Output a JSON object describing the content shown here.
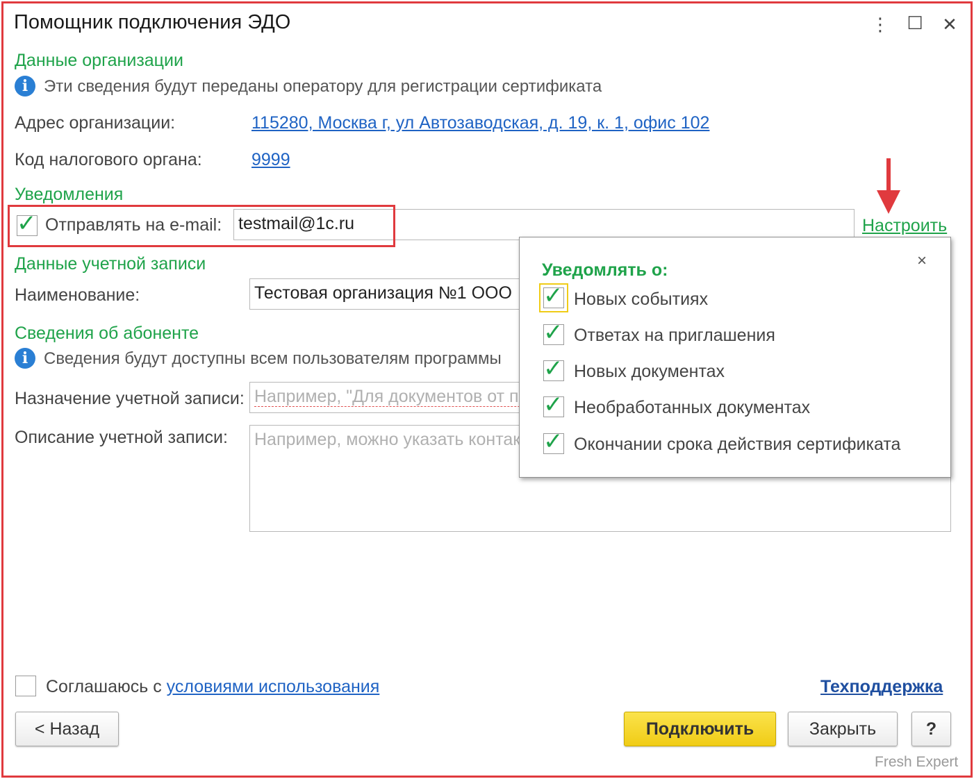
{
  "window": {
    "title": "Помощник подключения ЭДО",
    "more_glyph": "⋮",
    "maximize_glyph": "☐",
    "close_glyph": "✕"
  },
  "org_section": {
    "header": "Данные организации",
    "info_text": "Эти сведения будут переданы оператору для регистрации сертификата",
    "address_label": "Адрес организации:",
    "address_value": "115280, Москва г, ул Автозаводская, д. 19, к. 1, офис 102",
    "tax_label": "Код налогового органа:",
    "tax_value": "9999"
  },
  "notifications": {
    "header": "Уведомления",
    "send_email_label": "Отправлять на e-mail:",
    "send_email_checked": true,
    "email_value": "testmail@1c.ru",
    "configure_link": "Настроить"
  },
  "account_section": {
    "header": "Данные учетной записи",
    "name_label": "Наименование:",
    "name_value": "Тестовая организация №1 ООО"
  },
  "subscriber_section": {
    "header": "Сведения об абоненте",
    "info_text": "Сведения будут доступны всем пользователям программы",
    "purpose_label": "Назначение учетной записи:",
    "purpose_placeholder": "Например, \"Для документов от поставщиков\"",
    "description_label": "Описание учетной записи:",
    "description_placeholder": "Например, можно указать контактные данные"
  },
  "popup": {
    "title": "Уведомлять о:",
    "close_glyph": "×",
    "items": [
      {
        "label": "Новых событиях",
        "checked": true
      },
      {
        "label": "Ответах на приглашения",
        "checked": true
      },
      {
        "label": "Новых документах",
        "checked": true
      },
      {
        "label": "Необработанных документах",
        "checked": true
      },
      {
        "label": "Окончании срока действия сертификата",
        "checked": true
      }
    ]
  },
  "footer": {
    "agree_prefix": "Соглашаюсь с",
    "agree_link": "условиями использования",
    "agree_checked": false,
    "support_link": "Техподдержка",
    "back_button": "< Назад",
    "connect_button": "Подключить",
    "close_button": "Закрыть",
    "help_button": "?",
    "watermark": "Fresh Expert"
  },
  "colors": {
    "accent_green": "#1fa34a",
    "link_blue": "#1f63c4",
    "highlight_red": "#e03a3e",
    "primary_yellow": "#f0cc16"
  }
}
